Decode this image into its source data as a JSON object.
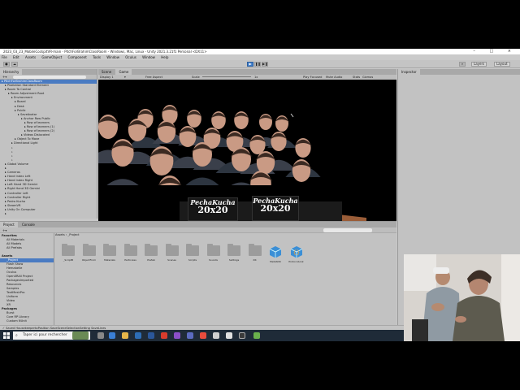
{
  "window": {
    "title": "2023_03_23_MobileCockpitVR-main - PitchForBrahimClassRoom - Windows, Mac, Linux - Unity 2021.3.21f1 Personal <DX11>",
    "controls": "– □ ×"
  },
  "menu": [
    "File",
    "Edit",
    "Assets",
    "GameObject",
    "Component",
    "Tools",
    "Window",
    "Oculus",
    "Window",
    "Help"
  ],
  "toolbar": {
    "play": "▶",
    "pause": "❚❚",
    "step": "▶❚",
    "layers_label": "Layers",
    "layout_label": "Layout"
  },
  "hierarchy": {
    "tab_label": "Hierarchy",
    "items": [
      "PitchForBrahimClassRoom",
      "Pixelation Standard Element",
      "Room To Control",
      "Room Adjustment Root",
      "Environment",
      "Board",
      "Desk",
      "Public",
      "SaveAvatar",
      "Anchor Row Public",
      "Row of learners",
      "Row of learners (1)",
      "Row of learners (2)",
      "Videos Dislocated",
      "Object To Move",
      "Directional Light",
      "",
      "",
      "",
      "",
      "Global Volume",
      "",
      "Cameras",
      "Hand Index Left",
      "Hand Index Right",
      "Left Hand 3D Gemini",
      "Right Hand 3D Gemini",
      "Controller Left",
      "Controller Right",
      "Pedro Kucha",
      "SteamVR",
      "Unity On Computer",
      ""
    ]
  },
  "scene": {
    "tabs": [
      "Scene",
      "Game"
    ],
    "display": "Display 1",
    "aspect": "Free Aspect",
    "scale_label": "Scale",
    "scale_value": "1x",
    "play_focused": "Play Focused",
    "mute": "Mute Audio",
    "stats": "Stats",
    "gizmos": "Gizmos",
    "board_top": "PechaKucha",
    "board_bottom": "20x20"
  },
  "inspector": {
    "tab_label": "Inspector"
  },
  "project": {
    "tabs": [
      "Project",
      "Console"
    ],
    "breadcrumb": "Assets › _Project",
    "tree": [
      {
        "label": "Favorites",
        "header": true
      },
      {
        "label": "All Materials"
      },
      {
        "label": "All Models"
      },
      {
        "label": "All Prefabs"
      },
      {
        "label": ""
      },
      {
        "label": "Assets",
        "header": true
      },
      {
        "label": "_Project",
        "selected": true
      },
      {
        "label": "Flash Show"
      },
      {
        "label": "Hemabelle"
      },
      {
        "label": "Oculus"
      },
      {
        "label": "OpenXRAll Project"
      },
      {
        "label": "PackagesImported"
      },
      {
        "label": "Resources"
      },
      {
        "label": "Samples"
      },
      {
        "label": "TextMeshPro"
      },
      {
        "label": "Uniform"
      },
      {
        "label": "Video"
      },
      {
        "label": "XR"
      },
      {
        "label": "Packages",
        "header": true
      },
      {
        "label": "Burst"
      },
      {
        "label": "Core RP Library"
      },
      {
        "label": "Custom NUnit"
      }
    ],
    "assets": [
      {
        "label": "_ScriptB",
        "type": "folder"
      },
      {
        "label": "ObjectFrom",
        "type": "folder"
      },
      {
        "label": "Materials",
        "type": "folder"
      },
      {
        "label": "Particules",
        "type": "folder"
      },
      {
        "label": "Prefab",
        "type": "folder"
      },
      {
        "label": "Scenes",
        "type": "folder"
      },
      {
        "label": "Scripts",
        "type": "folder"
      },
      {
        "label": "Sounds",
        "type": "folder"
      },
      {
        "label": "Settings",
        "type": "folder"
      },
      {
        "label": "XR",
        "type": "folder"
      },
      {
        "label": "MetaSDK",
        "type": "prefab"
      },
      {
        "label": "ProtocolLink",
        "type": "prefab"
      }
    ]
  },
  "status": "✓ Saved HousekeepertoPosition  SaveSceneSelectionSetting SaveLines",
  "taskbar": {
    "search_placeholder": "Taper ici pour rechercher",
    "systray": "🔔"
  },
  "colors": {
    "selection": "#4a7bc2",
    "editor_bg": "#c2c2c2",
    "taskbar": "#1f2b38",
    "scene_bg": "#000000"
  }
}
